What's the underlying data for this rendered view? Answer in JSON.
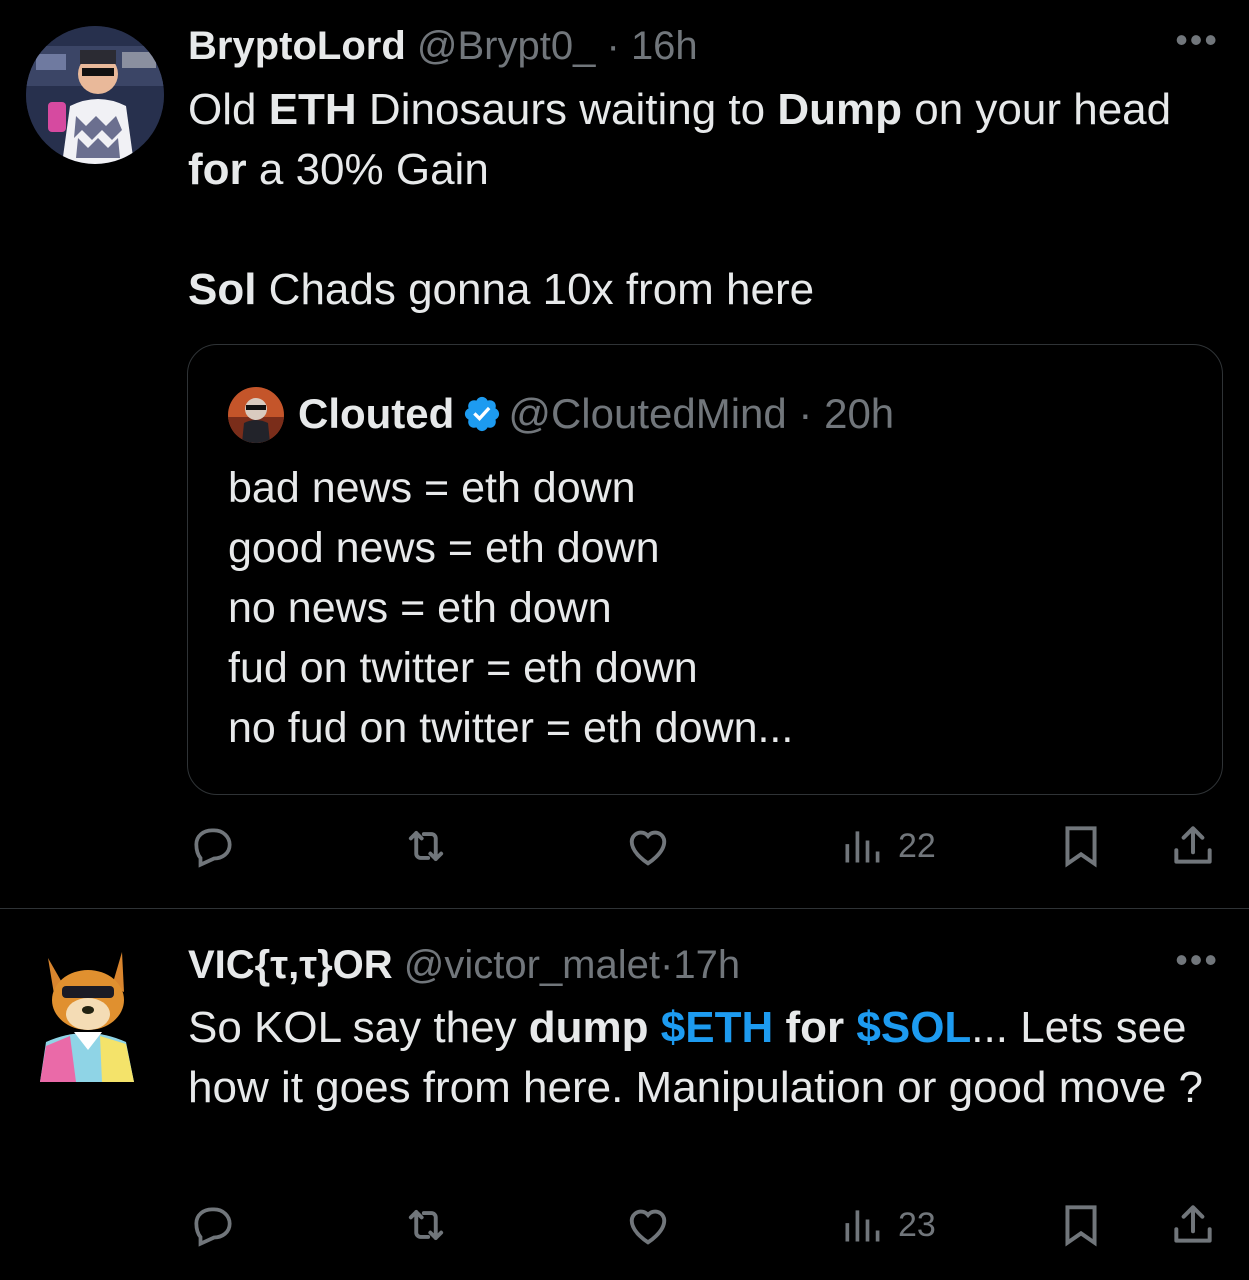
{
  "tweets": [
    {
      "display_name": "BryptoLord",
      "handle": "@Brypt0_",
      "separator": "·",
      "time": "16h",
      "more": "•••",
      "body": {
        "p1_s1": "Old ",
        "p1_b1": "ETH",
        "p1_s2": " Dinosaurs waiting to ",
        "p1_b2": "Dump",
        "p1_s3": " on your head ",
        "p1_b3": "for",
        "p1_s4": " a 30% Gain",
        "p2_b1": "Sol",
        "p2_s1": " Chads gonna 10x from here"
      },
      "quote": {
        "display_name": "Clouted",
        "verified": true,
        "handle": "@CloutedMind",
        "separator": "·",
        "time": "20h",
        "lines": [
          "bad news = eth down",
          "good news = eth down",
          "no news = eth down",
          "fud on twitter = eth down",
          "no fud on twitter = eth down..."
        ]
      },
      "actions": {
        "reply_icon": "reply-icon",
        "retweet_icon": "retweet-icon",
        "like_icon": "heart-icon",
        "views_icon": "views-icon",
        "views_count": "22",
        "bookmark_icon": "bookmark-icon",
        "share_icon": "share-icon"
      }
    },
    {
      "display_name": "VIC{τ,τ}OR",
      "handle": "@victor_malet",
      "separator": "·",
      "time": "17h",
      "more": "•••",
      "body": {
        "s1": "So KOL say they ",
        "b1": "dump",
        "s2": " ",
        "cash1": "$ETH",
        "s3": " ",
        "b2": "for",
        "s4": " ",
        "cash2": "$SOL",
        "s5": "... Lets see how it goes from here. Manipulation or good move ?"
      },
      "actions": {
        "views_count": "23"
      }
    }
  ],
  "colors": {
    "background": "#000000",
    "text": "#e7e9ea",
    "muted": "#71767b",
    "accent": "#1d9bf0",
    "border": "#2f3336"
  }
}
